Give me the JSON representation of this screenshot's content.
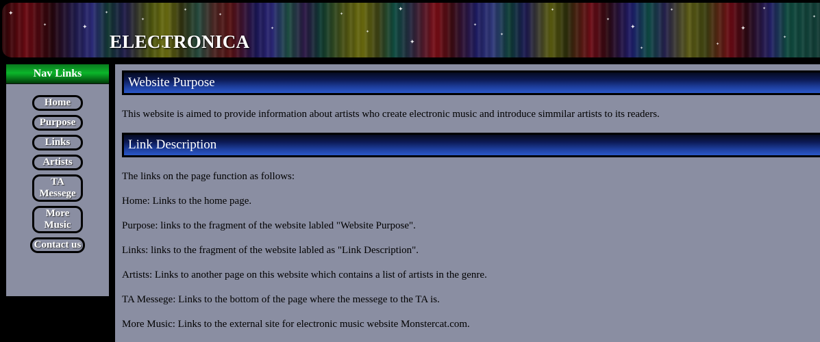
{
  "site": {
    "title": "ELECTRONICA"
  },
  "sidebar": {
    "header": "Nav Links",
    "items": [
      {
        "label": "Home"
      },
      {
        "label": "Purpose"
      },
      {
        "label": "Links"
      },
      {
        "label": "Artists"
      },
      {
        "label": "TA Messege"
      },
      {
        "label": "More Music"
      },
      {
        "label": "Contact us"
      }
    ]
  },
  "main": {
    "purpose": {
      "heading": "Website Purpose",
      "text": "This website is aimed to provide information about artists who create electronic music and introduce simmilar artists to its readers."
    },
    "links": {
      "heading": "Link Description",
      "intro": "The links on the page function as follows:",
      "items": [
        "Home: Links to the home page.",
        "Purpose: links to the fragment of the website labled \"Website Purpose\".",
        "Links: links to the fragment of the website labled as \"Link Description\".",
        "Artists: Links to another page on this website which contains a list of artists in the genre.",
        "TA Messege: Links to the bottom of the page where the messege to the TA is.",
        "More Music: Links to the external site for electronic music website Monstercat.com."
      ]
    }
  }
}
